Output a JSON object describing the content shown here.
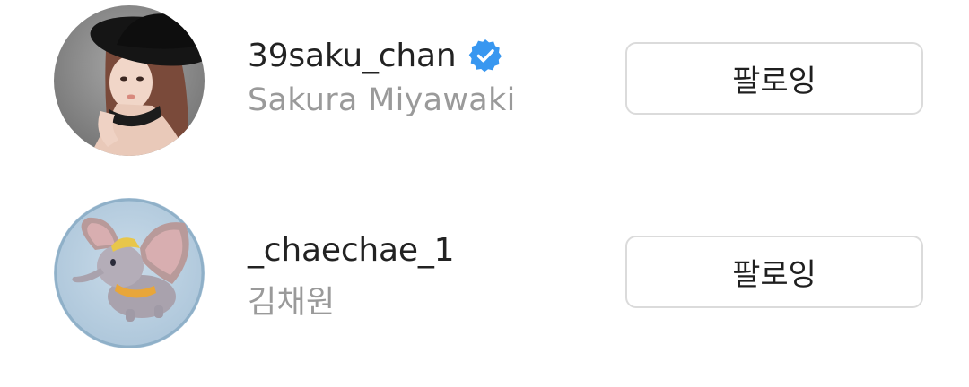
{
  "following_list": [
    {
      "avatar_icon": "profile-photo-avatar-icon",
      "username": "39saku_chan",
      "verified": true,
      "verified_icon": "verified-badge-icon",
      "full_name": "Sakura Miyawaki",
      "button_label": "팔로잉"
    },
    {
      "avatar_icon": "dumbo-elephant-avatar-icon",
      "username": "_chaechae_1",
      "verified": false,
      "full_name": "김채원",
      "button_label": "팔로잉"
    }
  ],
  "colors": {
    "username": "#222222",
    "full_name": "#9a9a9a",
    "verified_blue": "#3897f0",
    "button_border": "#dbdbdb"
  }
}
